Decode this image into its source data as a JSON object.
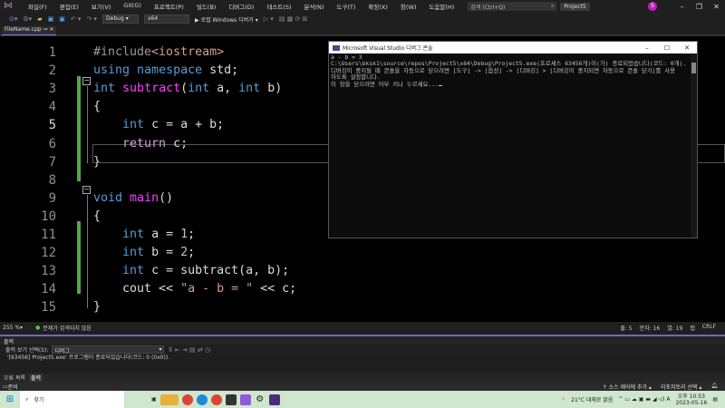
{
  "menu": {
    "items": [
      "파일(F)",
      "편집(E)",
      "보기(V)",
      "Git(G)",
      "프로젝트(P)",
      "빌드(B)",
      "디버그(D)",
      "테스트(S)",
      "분석(N)",
      "도구(T)",
      "확장(X)",
      "창(W)",
      "도움말(H)"
    ],
    "search": "검색 (Ctrl+Q)",
    "project": "Project5",
    "avatar": "S"
  },
  "toolbar": {
    "config": "Debug",
    "platform": "x64",
    "run": "▶ 로컬 Windows 디버거"
  },
  "tab": {
    "label": "FileName.cpp",
    "pin": "⊸",
    "close": "✕"
  },
  "code": {
    "lines": [
      [
        [
          "#include",
          "pp"
        ],
        [
          "<iostream>",
          "inc"
        ]
      ],
      [
        [
          "using",
          "kw"
        ],
        [
          " ",
          ""
        ],
        [
          "namespace",
          "kw"
        ],
        [
          " std;",
          ""
        ]
      ],
      [
        [
          "int",
          "kw"
        ],
        [
          " ",
          ""
        ],
        [
          "subtract",
          "fn"
        ],
        [
          "(",
          ""
        ],
        [
          "int",
          "kw"
        ],
        [
          " a, ",
          ""
        ],
        [
          "int",
          "kw"
        ],
        [
          " b)",
          ""
        ]
      ],
      [
        [
          "{",
          ""
        ]
      ],
      [
        [
          "    ",
          ""
        ],
        [
          "int",
          "kw"
        ],
        [
          " c = a + b;",
          ""
        ]
      ],
      [
        [
          "    ",
          ""
        ],
        [
          "return",
          "ctl"
        ],
        [
          " c;",
          ""
        ]
      ],
      [
        [
          "}",
          ""
        ]
      ],
      [],
      [
        [
          "void",
          "kw"
        ],
        [
          " ",
          ""
        ],
        [
          "main",
          "fn"
        ],
        [
          "()",
          ""
        ]
      ],
      [
        [
          "{",
          ""
        ]
      ],
      [
        [
          "    ",
          ""
        ],
        [
          "int",
          "kw"
        ],
        [
          " a = ",
          ""
        ],
        [
          "1",
          "num"
        ],
        [
          ";",
          ""
        ]
      ],
      [
        [
          "    ",
          ""
        ],
        [
          "int",
          "kw"
        ],
        [
          " b = ",
          ""
        ],
        [
          "2",
          "num"
        ],
        [
          ";",
          ""
        ]
      ],
      [
        [
          "    ",
          ""
        ],
        [
          "int",
          "kw"
        ],
        [
          " c = subtract(a, b);",
          ""
        ]
      ],
      [
        [
          "    cout << ",
          ""
        ],
        [
          "\"a - b = \"",
          "str"
        ],
        [
          " << c;",
          ""
        ]
      ],
      [
        [
          "}",
          ""
        ]
      ]
    ],
    "current_line": 5
  },
  "console": {
    "title": "Microsoft Visual Studio 디버그 콘솔",
    "output": "a - b = 3\nC:\\Users\\bksk1\\source\\repos\\Project5\\x64\\Debug\\Project5.exe(프로세스 63456개)이(가) 종료되었습니다(코드: 0개).\n디버깅이 중지될 때 콘솔을 자동으로 닫으려면 [도구] -> [옵션] -> [디버깅] > [디버깅이 중지되면 자동으로 콘솔 닫기]를 사용\n하도록 설정합니다.\n이 창을 닫으려면 아무 키나 누르세요..."
  },
  "editor_status": {
    "zoom": "255 %",
    "issues": "문제가 검색되지 않음",
    "line": "줄: 5",
    "char": "문자: 16",
    "col": "열: 19",
    "tab": "탭",
    "eol": "CRLF"
  },
  "output": {
    "title": "출력",
    "show_label": "출력 보기 선택(S):",
    "source": "디버그",
    "lines": "'[63456] Project5.exe' 프로그램이 종료되었습니다(코드: 0 (0x0))."
  },
  "bottom_tabs": [
    "오류 목록",
    "출력"
  ],
  "status": {
    "ready": "준비",
    "source_control": "↑ 소스 제어에 추가 ▴",
    "repo": "리포지토리 선택 ▴"
  },
  "taskbar": {
    "search": "찾기",
    "weather": "21°C  대체로 맑음",
    "time": "오후 10:53",
    "date": "2023-05-16"
  }
}
